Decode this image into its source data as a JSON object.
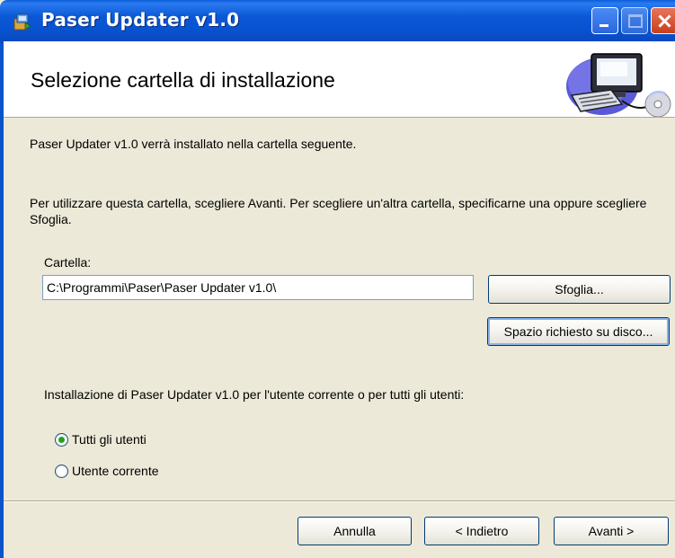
{
  "window": {
    "title": "Paser Updater v1.0"
  },
  "header": {
    "title": "Selezione cartella di installazione"
  },
  "body": {
    "intro": "Paser Updater v1.0 verrà installato nella cartella seguente.",
    "instructions": "Per utilizzare questa cartella, scegliere Avanti. Per scegliere un'altra cartella, specificarne una oppure scegliere Sfoglia.",
    "folder_label": "Cartella:",
    "folder_value": "C:\\Programmi\\Paser\\Paser Updater v1.0\\",
    "browse_label": "Sfoglia...",
    "disk_space_label": "Spazio richiesto su disco...",
    "scope_label": "Installazione di Paser Updater v1.0 per l'utente corrente o per tutti gli utenti:",
    "options": [
      {
        "label": "Tutti gli utenti",
        "selected": true
      },
      {
        "label": "Utente corrente",
        "selected": false
      }
    ]
  },
  "footer": {
    "cancel_label": "Annulla",
    "back_label": "< Indietro",
    "next_label": "Avanti >"
  },
  "icons": {
    "app": "installer-icon",
    "banner": "computer-cd-icon"
  },
  "colors": {
    "titlebar": "#0a5ed9",
    "dialog_bg": "#ece9d8",
    "banner_bg": "#ffffff",
    "radio_dot": "#21a121",
    "close_button": "#c8401c"
  }
}
